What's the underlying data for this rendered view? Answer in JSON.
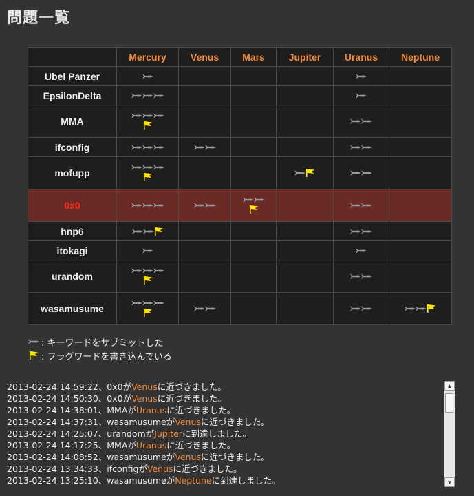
{
  "title": "問題一覧",
  "table": {
    "columns": [
      "Mercury",
      "Venus",
      "Mars",
      "Jupiter",
      "Uranus",
      "Neptune"
    ],
    "rows": [
      {
        "name": "Ubel Panzer",
        "self": false,
        "cells": [
          {
            "ships": 1,
            "flag": false
          },
          {
            "ships": 0,
            "flag": false
          },
          {
            "ships": 0,
            "flag": false
          },
          {
            "ships": 0,
            "flag": false
          },
          {
            "ships": 1,
            "flag": false
          },
          {
            "ships": 0,
            "flag": false
          }
        ]
      },
      {
        "name": "EpsilonDelta",
        "self": false,
        "cells": [
          {
            "ships": 3,
            "flag": false
          },
          {
            "ships": 0,
            "flag": false
          },
          {
            "ships": 0,
            "flag": false
          },
          {
            "ships": 0,
            "flag": false
          },
          {
            "ships": 1,
            "flag": false
          },
          {
            "ships": 0,
            "flag": false
          }
        ]
      },
      {
        "name": "MMA",
        "self": false,
        "cells": [
          {
            "ships": 3,
            "flag": true,
            "flagBelow": true
          },
          {
            "ships": 0,
            "flag": false
          },
          {
            "ships": 0,
            "flag": false
          },
          {
            "ships": 0,
            "flag": false
          },
          {
            "ships": 2,
            "flag": false
          },
          {
            "ships": 0,
            "flag": false
          }
        ]
      },
      {
        "name": "ifconfig",
        "self": false,
        "cells": [
          {
            "ships": 3,
            "flag": false
          },
          {
            "ships": 2,
            "flag": false
          },
          {
            "ships": 0,
            "flag": false
          },
          {
            "ships": 0,
            "flag": false
          },
          {
            "ships": 2,
            "flag": false
          },
          {
            "ships": 0,
            "flag": false
          }
        ]
      },
      {
        "name": "mofupp",
        "self": false,
        "cells": [
          {
            "ships": 3,
            "flag": true,
            "flagBelow": true
          },
          {
            "ships": 0,
            "flag": false
          },
          {
            "ships": 0,
            "flag": false
          },
          {
            "ships": 1,
            "flag": true,
            "flagBelow": false
          },
          {
            "ships": 2,
            "flag": false
          },
          {
            "ships": 0,
            "flag": false
          }
        ]
      },
      {
        "name": "0x0",
        "self": true,
        "cells": [
          {
            "ships": 3,
            "flag": false
          },
          {
            "ships": 2,
            "flag": false
          },
          {
            "ships": 2,
            "flag": true,
            "flagBelow": true
          },
          {
            "ships": 0,
            "flag": false
          },
          {
            "ships": 2,
            "flag": false
          },
          {
            "ships": 0,
            "flag": false
          }
        ]
      },
      {
        "name": "hnp6",
        "self": false,
        "cells": [
          {
            "ships": 2,
            "flag": true,
            "flagBelow": false
          },
          {
            "ships": 0,
            "flag": false
          },
          {
            "ships": 0,
            "flag": false
          },
          {
            "ships": 0,
            "flag": false
          },
          {
            "ships": 2,
            "flag": false
          },
          {
            "ships": 0,
            "flag": false
          }
        ]
      },
      {
        "name": "itokagi",
        "self": false,
        "cells": [
          {
            "ships": 1,
            "flag": false
          },
          {
            "ships": 0,
            "flag": false
          },
          {
            "ships": 0,
            "flag": false
          },
          {
            "ships": 0,
            "flag": false
          },
          {
            "ships": 1,
            "flag": false
          },
          {
            "ships": 0,
            "flag": false
          }
        ]
      },
      {
        "name": "urandom",
        "self": false,
        "cells": [
          {
            "ships": 3,
            "flag": true,
            "flagBelow": true
          },
          {
            "ships": 0,
            "flag": false
          },
          {
            "ships": 0,
            "flag": false
          },
          {
            "ships": 0,
            "flag": false
          },
          {
            "ships": 2,
            "flag": false
          },
          {
            "ships": 0,
            "flag": false
          }
        ]
      },
      {
        "name": "wasamusume",
        "self": false,
        "cells": [
          {
            "ships": 3,
            "flag": true,
            "flagBelow": true
          },
          {
            "ships": 2,
            "flag": false
          },
          {
            "ships": 0,
            "flag": false
          },
          {
            "ships": 0,
            "flag": false
          },
          {
            "ships": 2,
            "flag": false
          },
          {
            "ships": 2,
            "flag": true,
            "flagBelow": false
          }
        ]
      }
    ]
  },
  "legend": {
    "submitted": ": キーワードをサブミットした",
    "flag_written": ": フラグワードを書き込んでいる"
  },
  "log": [
    {
      "time": "2013-02-24 14:59:22、",
      "user": "0x0",
      "mid": "が",
      "planet": "Venus",
      "end": "に近づきました。"
    },
    {
      "time": "2013-02-24 14:50:30、",
      "user": "0x0",
      "mid": "が",
      "planet": "Venus",
      "end": "に近づきました。"
    },
    {
      "time": "2013-02-24 14:38:01、",
      "user": "MMA",
      "mid": "が",
      "planet": "Uranus",
      "end": "に近づきました。"
    },
    {
      "time": "2013-02-24 14:37:31、",
      "user": "wasamusume",
      "mid": "が",
      "planet": "Venus",
      "end": "に近づきました。"
    },
    {
      "time": "2013-02-24 14:25:07、",
      "user": "urandom",
      "mid": "が",
      "planet": "Jupiter",
      "end": "に到達しました。"
    },
    {
      "time": "2013-02-24 14:17:25、",
      "user": "MMA",
      "mid": "が",
      "planet": "Uranus",
      "end": "に近づきました。"
    },
    {
      "time": "2013-02-24 14:08:52、",
      "user": "wasamusume",
      "mid": "が",
      "planet": "Venus",
      "end": "に近づきました。"
    },
    {
      "time": "2013-02-24 13:34:33、",
      "user": "ifconfig",
      "mid": "が",
      "planet": "Venus",
      "end": "に近づきました。"
    },
    {
      "time": "2013-02-24 13:25:10、",
      "user": "wasamusume",
      "mid": "が",
      "planet": "Neptune",
      "end": "に到達しました。"
    }
  ],
  "colors": {
    "background": "#333333",
    "accent": "#f08a3c",
    "self_row": "#6a2a25",
    "self_name": "#ff2a1a",
    "flag": "#ffe600",
    "ship": "#9a9a9a"
  },
  "icons": {
    "ship": "rocket-icon",
    "flag": "flag-icon"
  }
}
